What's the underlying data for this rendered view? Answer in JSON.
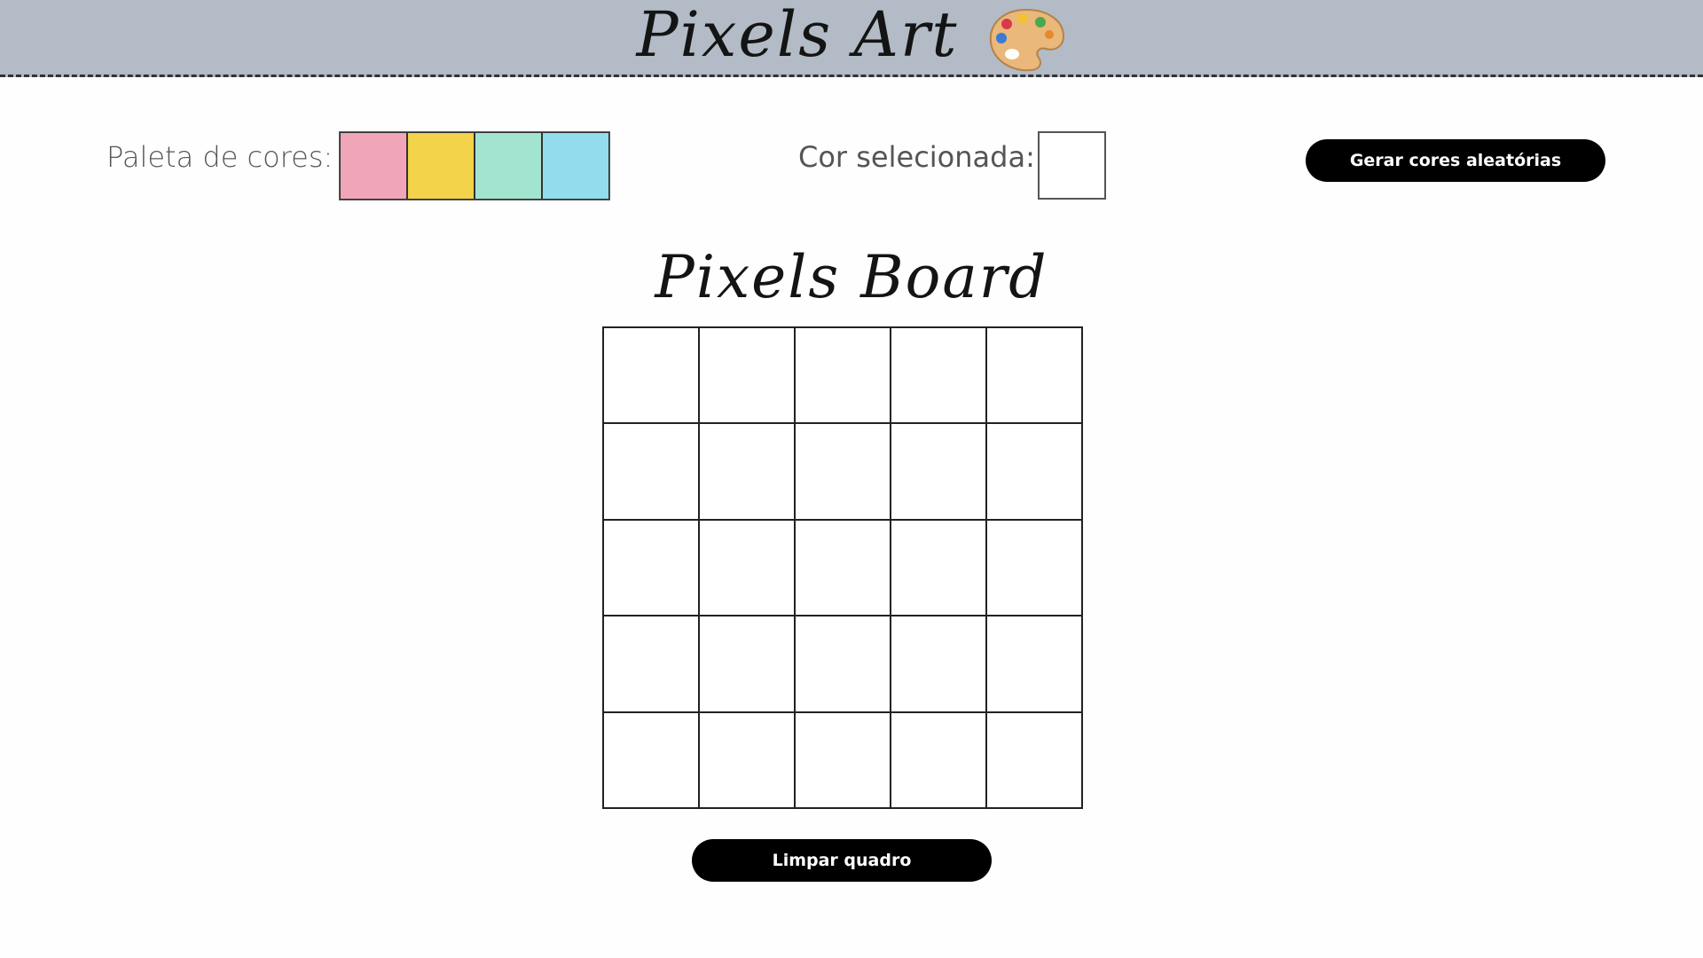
{
  "header": {
    "title": "Pixels Art",
    "icon": "artist-palette-icon"
  },
  "palette": {
    "label": "Paleta de cores:",
    "colors": [
      "#f0a5b8",
      "#f2d34a",
      "#a3e4d0",
      "#92dced"
    ]
  },
  "selected": {
    "label": "Cor selecionada:",
    "color": "#ffffff"
  },
  "buttons": {
    "random_colors": "Gerar cores aleatórias",
    "clear_board": "Limpar quadro"
  },
  "board": {
    "title": "Pixels Board",
    "rows": 5,
    "cols": 5,
    "pixel_color": "#ffffff"
  }
}
